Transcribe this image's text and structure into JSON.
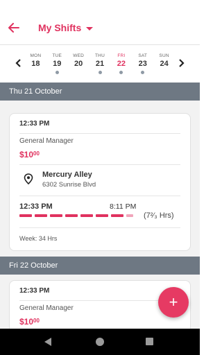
{
  "header": {
    "title": "My Shifts"
  },
  "week": {
    "days": [
      {
        "name": "MON",
        "num": "18",
        "dot": false
      },
      {
        "name": "TUE",
        "num": "19",
        "dot": true
      },
      {
        "name": "WED",
        "num": "20",
        "dot": false
      },
      {
        "name": "THU",
        "num": "21",
        "dot": true
      },
      {
        "name": "FRI",
        "num": "22",
        "dot": true,
        "today": true
      },
      {
        "name": "SAT",
        "num": "23",
        "dot": true
      },
      {
        "name": "SUN",
        "num": "24",
        "dot": false
      }
    ]
  },
  "sections": [
    {
      "header": "Thu 21 October",
      "shift": {
        "start_time": "12:33 PM",
        "role": "General Manager",
        "pay_dollars": "$10",
        "pay_cents": "00",
        "location_name": "Mercury Alley",
        "location_address": "6302 Sunrise Blvd",
        "end_time": "8:11 PM",
        "hours": "(7²⁄₃ Hrs)",
        "week_total": "Week: 34 Hrs"
      }
    },
    {
      "header": "Fri 22 October",
      "shift": {
        "start_time": "12:33 PM",
        "role": "General Manager",
        "pay_dollars": "$10",
        "pay_cents": "00"
      }
    }
  ],
  "fab": {
    "label": "+"
  },
  "colors": {
    "accent": "#e0325f",
    "section_bg": "#6e7883",
    "content_bg": "#f2f2f2"
  }
}
